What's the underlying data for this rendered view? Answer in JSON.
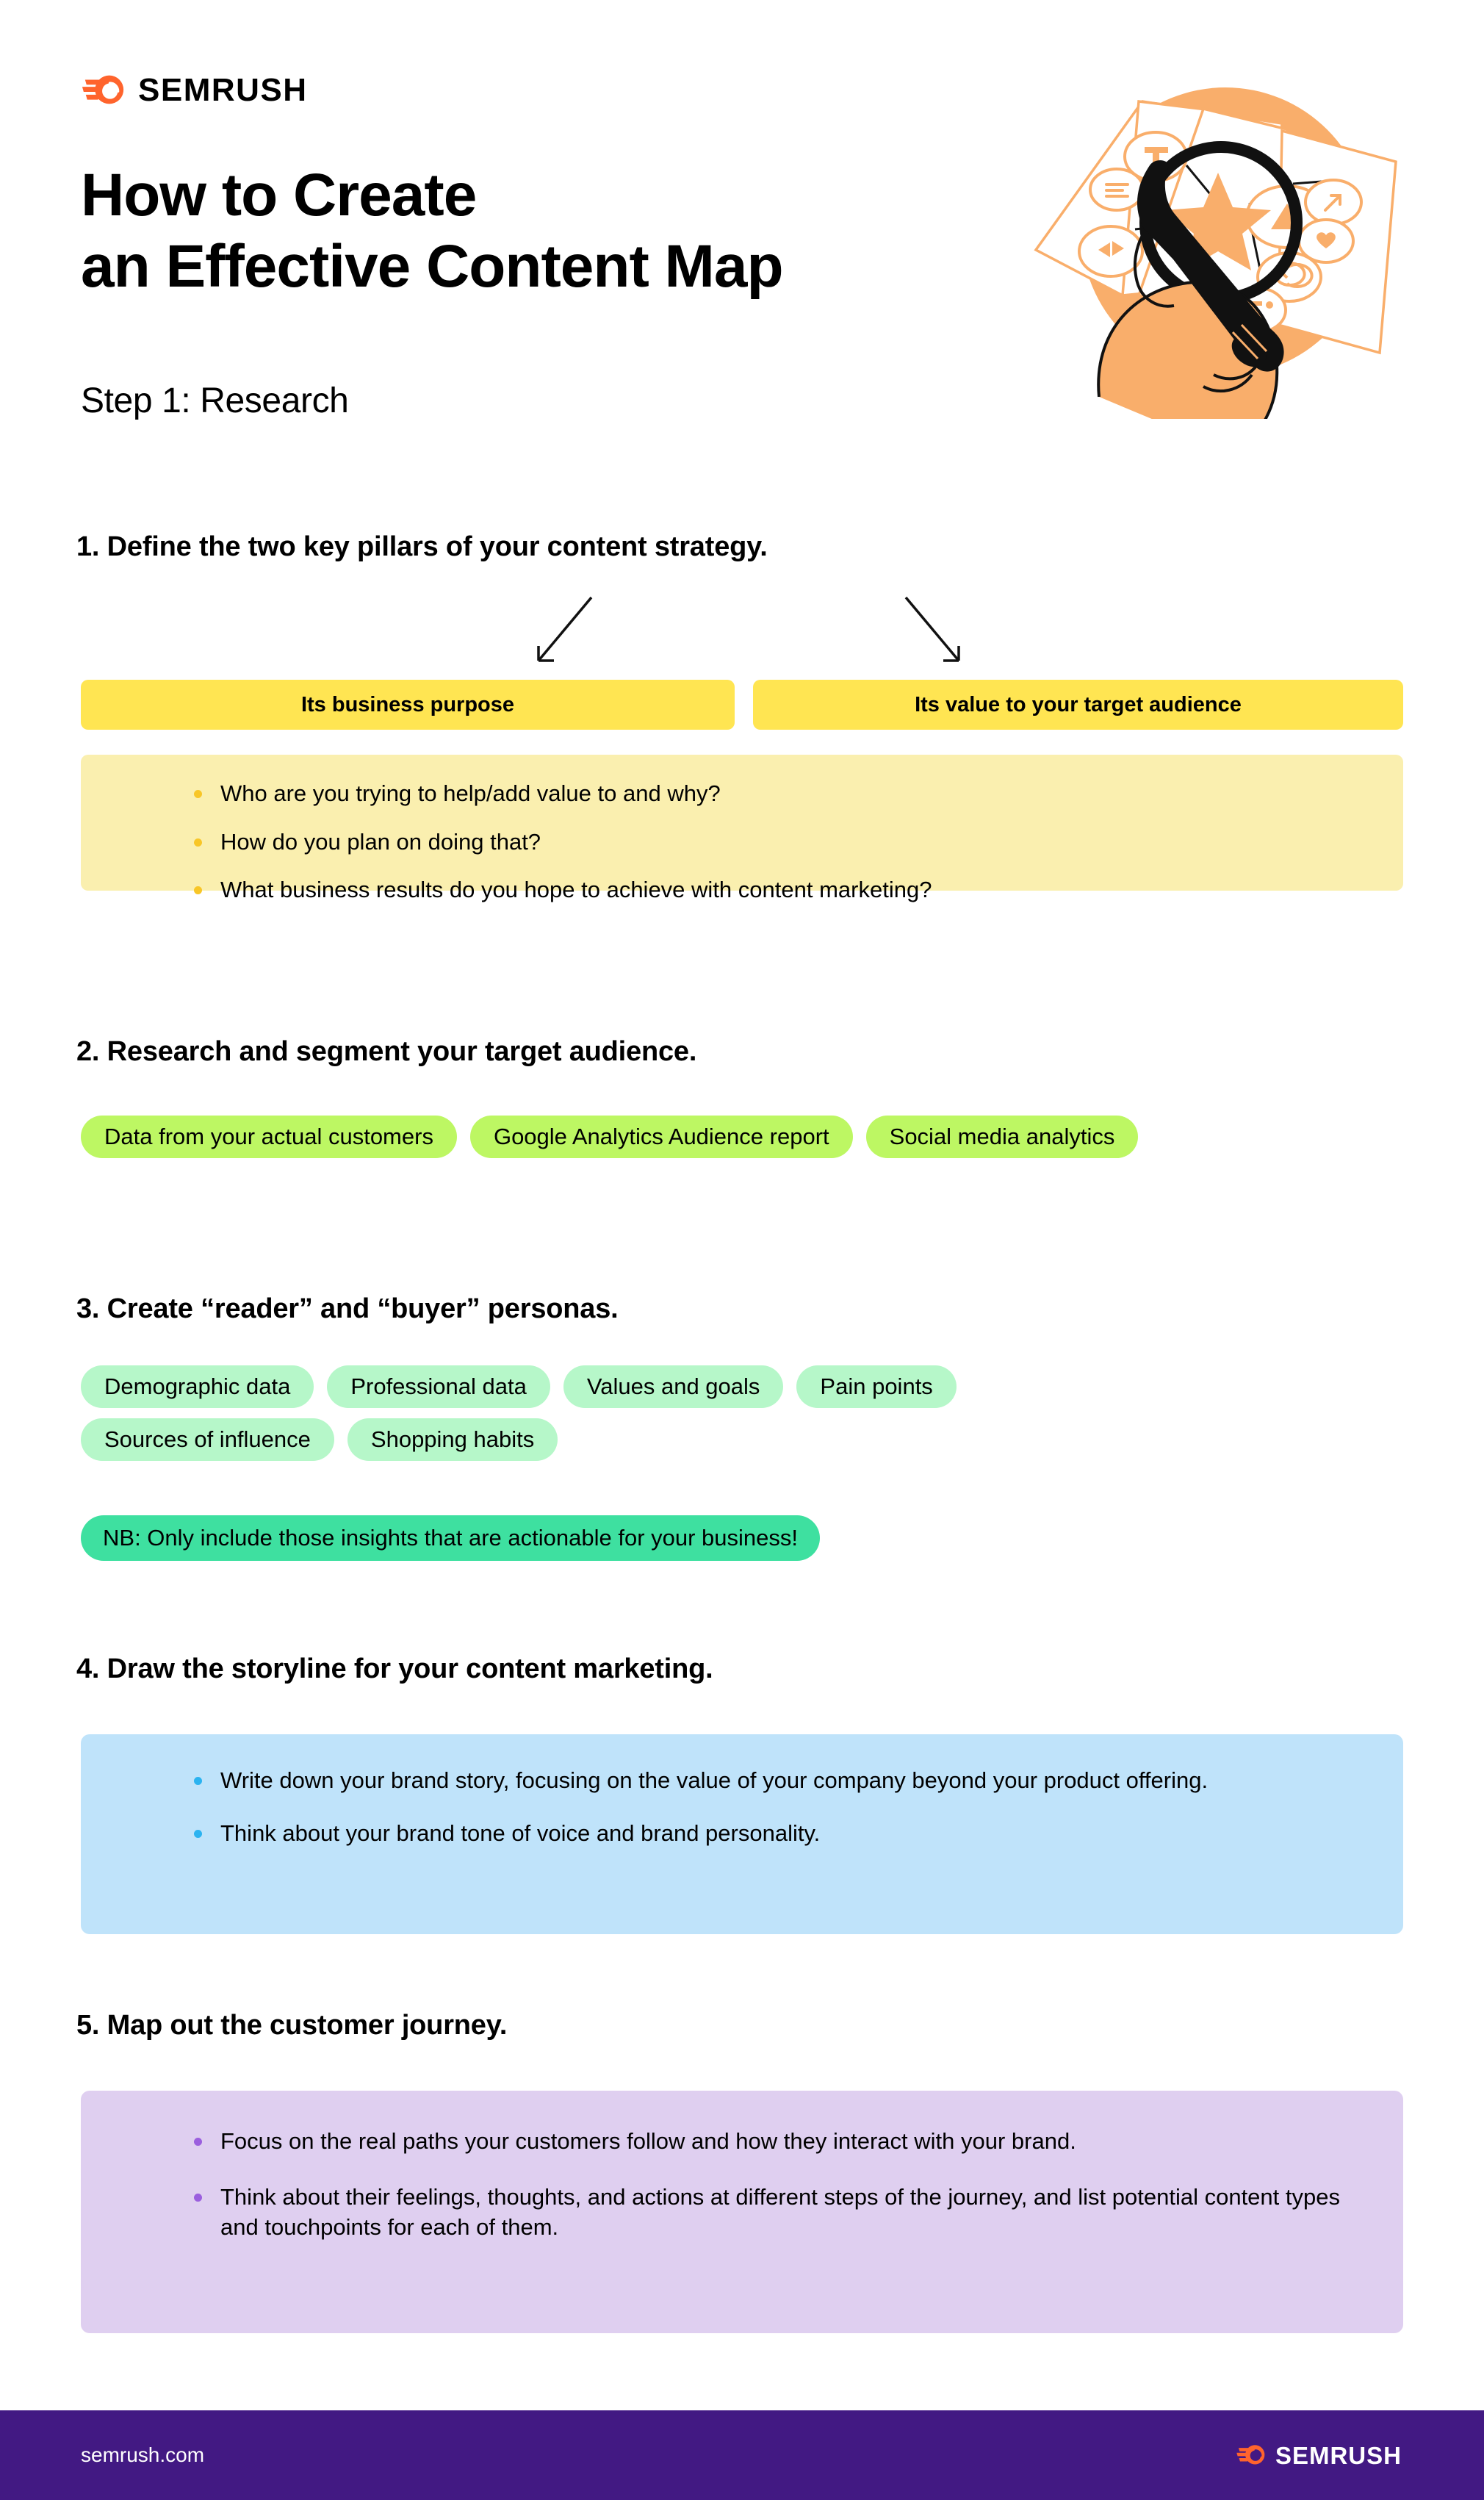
{
  "brand": {
    "name": "SEMRUSH",
    "logo_icon": "semrush-comet-icon",
    "accent_orange": "#FF642D",
    "footer_purple": "#421983"
  },
  "header": {
    "title_line1": "How to Create",
    "title_line2": "an Effective Content Map",
    "step_label": "Step 1: Research",
    "illustration_icon": "magnifying-glass-content-map-illustration"
  },
  "sections": [
    {
      "heading": "1. Define the two key pillars of your content strategy.",
      "arrows_icon": "two-down-arrows",
      "pillars": [
        "Its business purpose",
        "Its value to your target audience"
      ],
      "panel_color": "#FAEFAF",
      "bullet_color": "#F8C627",
      "bullets": [
        "Who are you trying to help/add value to and why?",
        "How do you plan on doing that?",
        "What business results do you hope to achieve with content marketing?"
      ]
    },
    {
      "heading": "2. Research and segment your target audience.",
      "pill_color": "#BDF763",
      "pills": [
        "Data from your actual customers",
        "Google Analytics Audience report",
        "Social media analytics"
      ]
    },
    {
      "heading": "3. Create “reader” and “buyer” personas.",
      "pill_color": "#B6F7C9",
      "pills": [
        "Demographic data",
        "Professional data",
        "Values and goals",
        "Pain points",
        "Sources of influence",
        "Shopping habits"
      ],
      "note_color": "#3EE0A0",
      "note": "NB: Only include those insights that are actionable for your business!"
    },
    {
      "heading": "4. Draw the storyline for your content marketing.",
      "panel_color": "#BFE3FA",
      "bullet_color": "#2BB3F0",
      "bullets": [
        "Write down your brand story, focusing on the value of your company beyond your product offering.",
        "Think about your brand tone of voice and brand personality."
      ]
    },
    {
      "heading": "5. Map out the customer journey.",
      "panel_color": "#DFCFF0",
      "bullet_color": "#9B5FDE",
      "bullets": [
        "Focus on the real paths your customers follow and how they interact with your brand.",
        "Think about their feelings, thoughts, and actions at different steps of the journey, and list potential content types and touchpoints for each of them."
      ]
    }
  ],
  "footer": {
    "url": "semrush.com",
    "brand": "SEMRUSH",
    "logo_icon": "semrush-comet-icon"
  }
}
